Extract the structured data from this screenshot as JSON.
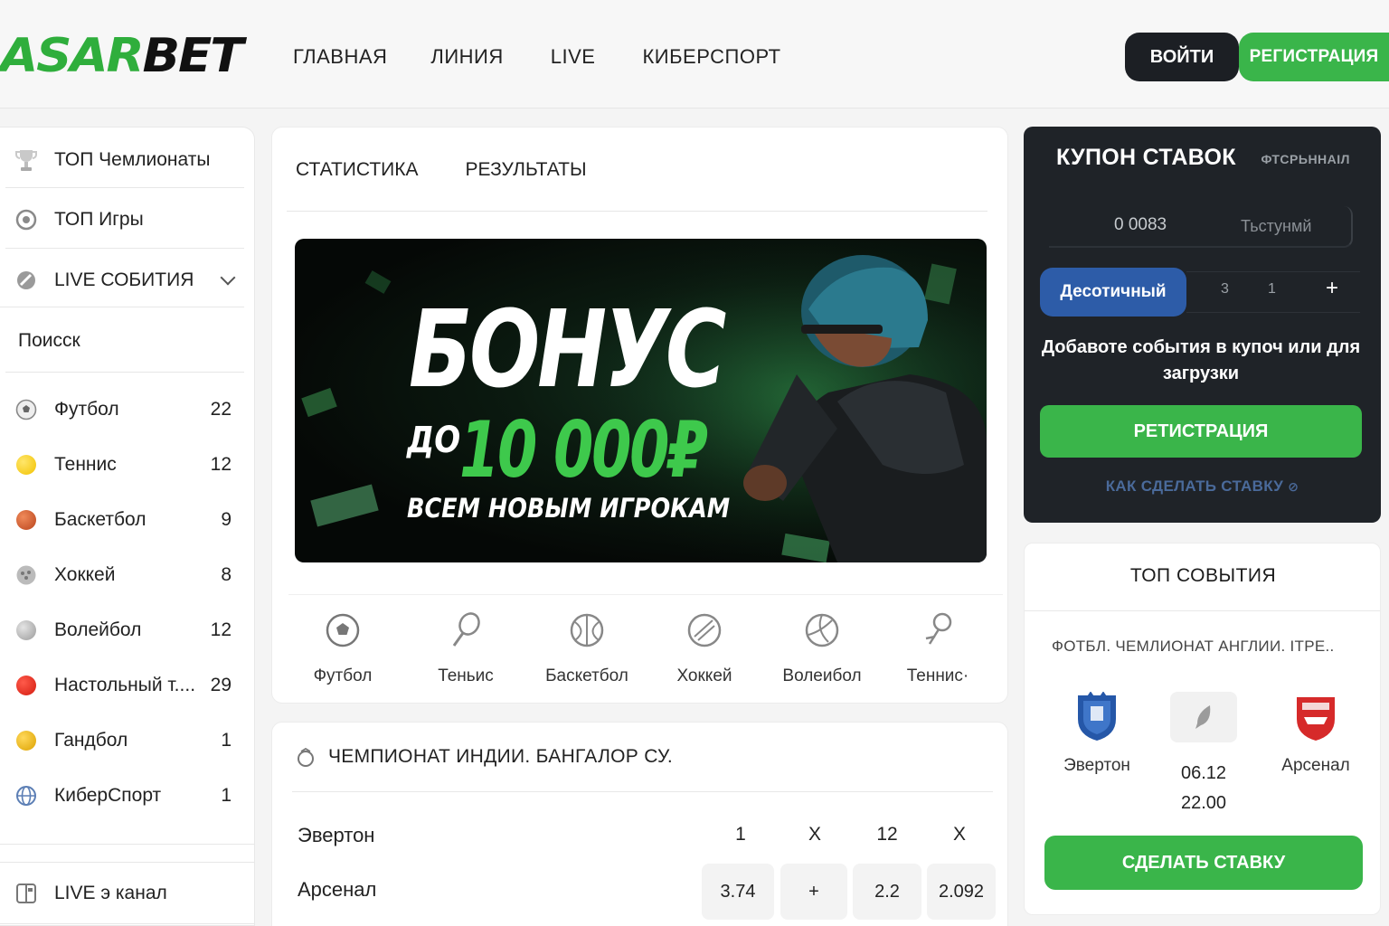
{
  "header": {
    "logo_part1": "ASAR",
    "logo_part2": "BET",
    "nav": [
      "ГЛАВНАЯ",
      "ЛИНИЯ",
      "LIVE",
      "КИБЕРСПОРТ"
    ],
    "login": "ВОЙТИ",
    "register": "РЕГИСТРАЦИЯ"
  },
  "sidebar": {
    "top_champs": "ТОП Чемлионаты",
    "top_games": "ТОП Игры",
    "live_events": "LIVE СОБИТИЯ",
    "search": "Поисск",
    "sports": [
      {
        "name": "Футбол",
        "count": "22",
        "icon": "soccer-ball-icon"
      },
      {
        "name": "Теннис",
        "count": "12",
        "icon": "tennis-ball-icon"
      },
      {
        "name": "Баскетбол",
        "count": "9",
        "icon": "basketball-icon"
      },
      {
        "name": "Хоккей",
        "count": "8",
        "icon": "hockey-icon"
      },
      {
        "name": "Волейбол",
        "count": "12",
        "icon": "volleyball-icon"
      },
      {
        "name": "Настольный т....",
        "count": "29",
        "icon": "table-tennis-icon"
      },
      {
        "name": "Гандбол",
        "count": "1",
        "icon": "handball-icon"
      },
      {
        "name": "КиберСпорт",
        "count": "1",
        "icon": "esports-globe-icon"
      }
    ],
    "live_channel": "LIVE э канал"
  },
  "center": {
    "tabs": [
      "СТАТИСТИКА",
      "РЕЗУЛЬТАТЫ"
    ],
    "banner": {
      "title": "БОНУС",
      "prefix": "ДО",
      "amount": "10 000₽",
      "subtitle": "ВСЕМ НОВЫМ ИГРОКАМ"
    },
    "sports_strip": [
      "Футбол",
      "Теньис",
      "Баскетбол",
      "Хоккей",
      "Волеибол",
      "Теннис·"
    ],
    "match": {
      "league": "ЧЕМПИОНАТ ИНДИИ. БАНГАЛОР СУ.",
      "team1": "Эвертон",
      "team2": "Арсенал",
      "odd_headers": [
        "1",
        "X",
        "12",
        "X"
      ],
      "odds": [
        "3.74",
        "+",
        "2.2",
        "2.092"
      ]
    }
  },
  "coupon": {
    "title": "КУПОН СТАВОК",
    "tag": "ФТСРЬННАІЛ",
    "value": "0 0083",
    "placeholder": "Тьстунмй",
    "format_button": "Десотичный",
    "options": [
      "3",
      "1"
    ],
    "plus": "+",
    "message": "Добавоте события в купоч или для загрузки",
    "register": "РЕТИСТРАЦИЯ",
    "how_to": "КАК СДЕЛАТЬ СТАВКУ"
  },
  "top_events": {
    "title": "ТОП СОВЫТИЯ",
    "league": "ФОТБЛ. ЧЕМЛИОНАТ АНГЛИИ. ІТРЕ..",
    "team1": "Эвертон",
    "team2": "Арсенал",
    "date": "06.12",
    "time": "22.00",
    "bet_button": "СДЕЛАТЬ СТАВКУ"
  },
  "colors": {
    "brand_green": "#3ab54a",
    "dark": "#1f2328",
    "coupon_blue": "#2d5ca8"
  }
}
